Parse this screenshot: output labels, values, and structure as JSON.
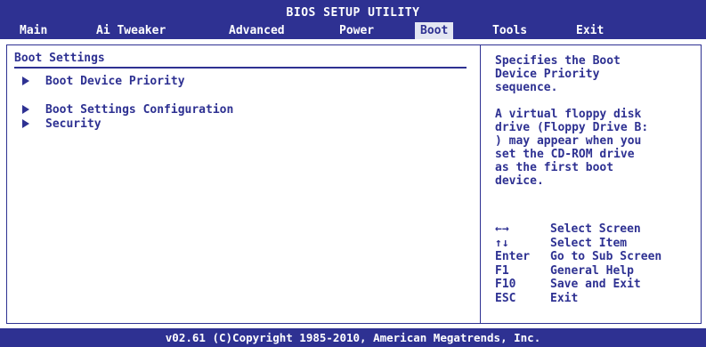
{
  "title": "BIOS SETUP UTILITY",
  "menu": [
    "Main",
    "Ai Tweaker",
    "Advanced",
    "Power",
    "Boot",
    "Tools",
    "Exit"
  ],
  "active_menu": "Boot",
  "section_title": "Boot Settings",
  "entries": [
    "Boot Device Priority",
    "Boot Settings Configuration",
    "Security"
  ],
  "help": {
    "line1": "Specifies the Boot\nDevice Priority\nsequence.",
    "line2": "A virtual floppy disk\ndrive (Floppy Drive B:\n) may appear when you\nset the CD-ROM drive\nas the first boot\ndevice."
  },
  "keys": [
    {
      "key": "←→",
      "action": "Select Screen"
    },
    {
      "key": "↑↓",
      "action": "Select Item"
    },
    {
      "key": "Enter",
      "action": "Go to Sub Screen"
    },
    {
      "key": "F1",
      "action": "General Help"
    },
    {
      "key": "F10",
      "action": "Save and Exit"
    },
    {
      "key": "ESC",
      "action": "Exit"
    }
  ],
  "footer": "v02.61 (C)Copyright 1985-2010, American Megatrends, Inc.",
  "colors": {
    "accent": "#2e3192",
    "highlight": "#e3e6f2",
    "background": "#ffffff"
  }
}
